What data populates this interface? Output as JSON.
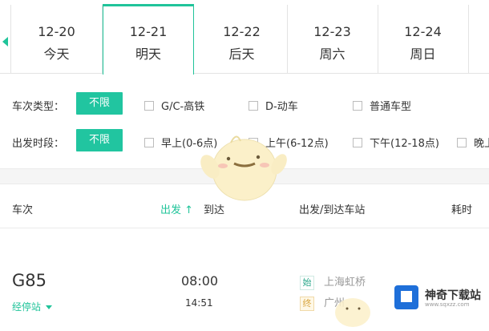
{
  "dates": [
    {
      "date": "12-20",
      "day": "今天"
    },
    {
      "date": "12-21",
      "day": "明天",
      "active": true
    },
    {
      "date": "12-22",
      "day": "后天"
    },
    {
      "date": "12-23",
      "day": "周六"
    },
    {
      "date": "12-24",
      "day": "周日"
    }
  ],
  "filters": {
    "train_type": {
      "label": "车次类型：",
      "selected": "不限",
      "options": [
        "G/C-高铁",
        "D-动车",
        "普通车型"
      ]
    },
    "depart_time": {
      "label": "出发时段：",
      "selected": "不限",
      "options": [
        "早上(0-6点)",
        "上午(6-12点)",
        "下午(12-18点)",
        "晚上"
      ]
    }
  },
  "table": {
    "headers": {
      "train": "车次",
      "depart": "出发 ↑",
      "arrive": "到达",
      "stations": "出发/到达车站",
      "duration": "耗时"
    },
    "rows": [
      {
        "train_no": "G85",
        "stops_label": "经停站",
        "depart_time": "08:00",
        "arrive_time": "14:51",
        "start_badge": "始",
        "start_station": "上海虹桥",
        "end_badge": "终",
        "end_station": "广州"
      }
    ]
  },
  "accent_color": "#20c49a",
  "watermark": {
    "name": "神奇下载站",
    "url": "www.sqxzz.com"
  }
}
